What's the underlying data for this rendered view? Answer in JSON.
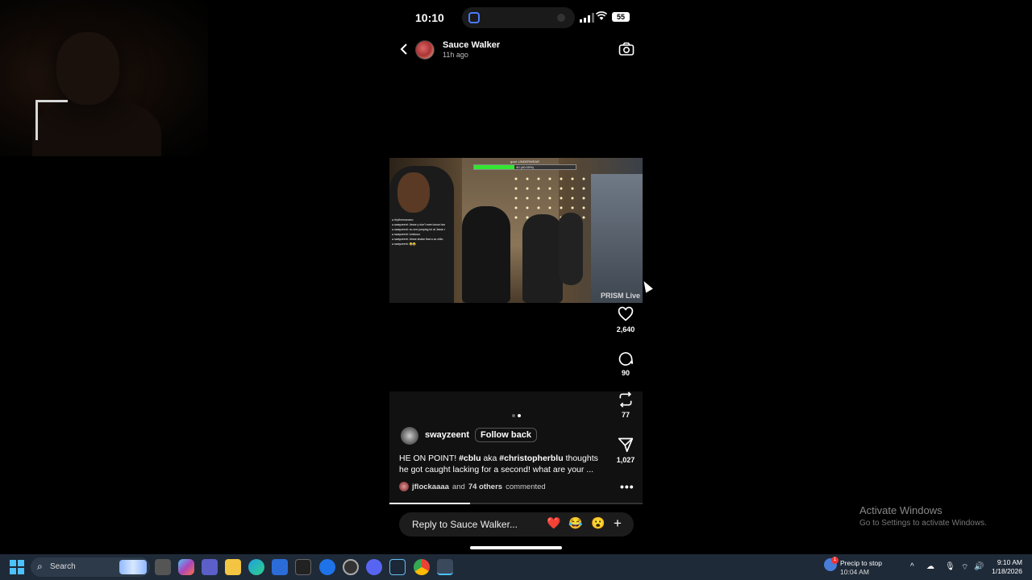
{
  "phone": {
    "status": {
      "time": "10:10",
      "battery": "55"
    },
    "story": {
      "username": "Sauce Walker",
      "time_ago": "11h ago"
    },
    "video": {
      "overlay_health_label": "goal: UNDERWEAR",
      "overlay_health_value": "40 (40.00%)",
      "overlay_health_fraction": 0.4,
      "watermark": "PRISM Live",
      "chat_lines": [
        "● rhythmmonono",
        "● swayzeent: Jesse y don't even know how to shoulder bop...",
        "● swayzeent: no one jumping lol at Jesse shakes his ass when he ...",
        "● swayzeent: Lmfaooo",
        "● swayzeent: Jesse shake that a ss chilu",
        "● swayzeent: 😂😂"
      ]
    },
    "actions": {
      "likes": "2,640",
      "comments": "90",
      "reposts": "77",
      "shares": "1,027"
    },
    "post": {
      "poster": "swayzeent",
      "follow_label": "Follow back",
      "caption_1": "HE ON POINT! ",
      "tag_1": "#cblu",
      "caption_2": " aka ",
      "tag_2": "#christopherblu",
      "caption_3": " thoughts he got caught lacking for a second! what are your ...",
      "commenter": "jflockaaaa",
      "commenters_mid": " and ",
      "others": "74 others",
      "commented": " commented",
      "progress": 0.32
    },
    "reply": {
      "placeholder": "Reply to Sauce Walker...",
      "emojis": [
        "❤️",
        "😂",
        "😮"
      ],
      "plus": "+"
    }
  },
  "watermark": {
    "title": "Activate Windows",
    "subtitle": "Go to Settings to activate Windows."
  },
  "taskbar": {
    "search_label": "Search",
    "weather_line1": "Precip to stop",
    "weather_line2": "10:04 AM",
    "weather_badge": "1",
    "time": "9:10 AM",
    "date": "1/18/2026"
  }
}
